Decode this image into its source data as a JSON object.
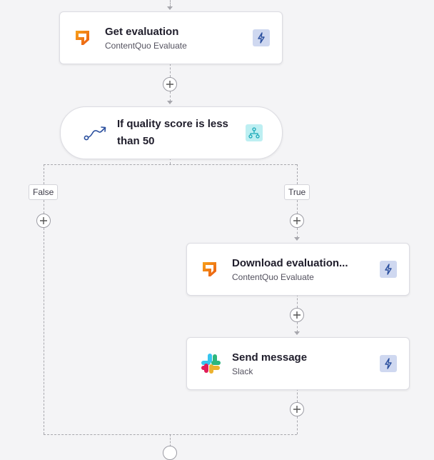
{
  "flow": {
    "get_evaluation": {
      "title": "Get evaluation",
      "app": "ContentQuo Evaluate",
      "logo_icon": "contentquo-logo-icon",
      "action_icon": "lightning-icon"
    },
    "condition": {
      "title_line1": "If quality score is less",
      "title_line2": "than 50",
      "icon": "route-icon",
      "type_icon": "branch-icon"
    },
    "branches": {
      "false_label": "False",
      "true_label": "True"
    },
    "download_evaluation": {
      "title": "Download evaluation...",
      "app": "ContentQuo Evaluate",
      "logo_icon": "contentquo-logo-icon",
      "action_icon": "lightning-icon"
    },
    "send_message": {
      "title": "Send message",
      "app": "Slack",
      "logo_icon": "slack-logo-icon",
      "action_icon": "lightning-icon"
    }
  },
  "colors": {
    "background": "#f4f4f6",
    "connector": "#a7a7ad",
    "action_badge": "#cfd8f0",
    "action_bolt": "#2a4f9e",
    "condition_badge": "#bdeff2",
    "condition_icon": "#1aa9b8",
    "route_icon": "#2a4f9e",
    "contentquo_orange": "#f27a1a"
  }
}
